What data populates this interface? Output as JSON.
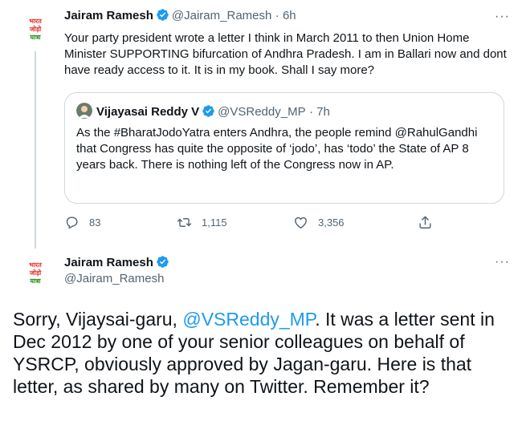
{
  "tweet1": {
    "display_name": "Jairam Ramesh",
    "handle": "@Jairam_Ramesh",
    "time": "· 6h",
    "text": "Your party president wrote a letter I think in March 2011 to then Union Home Minister SUPPORTING bifurcation of Andhra Pradesh. I am in Ballari now and dont have ready access to it. It is in my book. Shall I say more?",
    "avatar_text": [
      "भारत",
      "जोड़ो",
      "यात्रा"
    ]
  },
  "quote": {
    "display_name": "Vijayasai Reddy V",
    "handle": "@VSReddy_MP",
    "time": "· 7h",
    "text": "As the #BharatJodoYatra enters Andhra, the people remind @RahulGandhi that Congress has quite the opposite of ‘jodo’, has ‘todo’ the State of AP 8 years back. There is nothing left of the Congress now in AP."
  },
  "actions": {
    "replies": "83",
    "retweets": "1,115",
    "likes": "3,356"
  },
  "tweet2": {
    "display_name": "Jairam Ramesh",
    "handle": "@Jairam_Ramesh",
    "avatar_text": [
      "भारत",
      "जोड़ो",
      "यात्रा"
    ],
    "text_before_mention": "Sorry, Vijaysai-garu, ",
    "mention": "@VSReddy_MP",
    "text_after_mention": ". It was a letter sent in Dec 2012 by one of your senior colleagues on behalf of YSRCP, obviously approved by Jagan-garu. Here is that letter, as shared by many on Twitter. Remember it?"
  },
  "more_label": "···",
  "colors": {
    "accent": "#1d9bf0",
    "secondary_text": "#536471",
    "border": "#cfd9de",
    "logo_red": "#e52d27",
    "logo_green": "#138808"
  }
}
